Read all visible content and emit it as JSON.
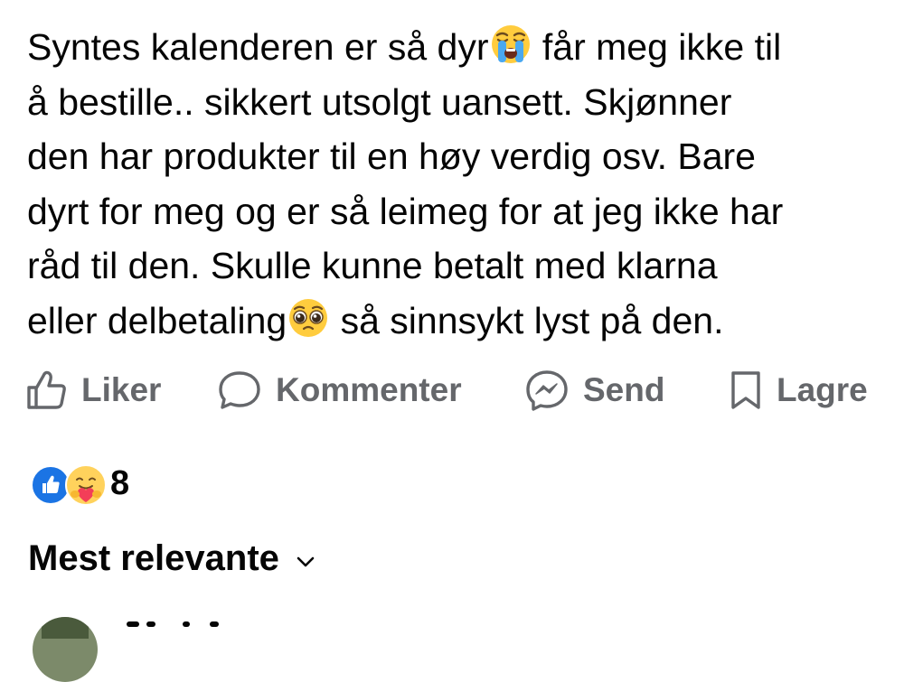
{
  "post": {
    "lines": [
      {
        "before": "Syntes kalenderen er så dyr",
        "emoji": "loudly-crying-face",
        "after": " får meg ikke til"
      },
      {
        "text": "å bestille.. sikkert utsolgt uansett. Skjønner"
      },
      {
        "text": "den har produkter til en høy verdig osv. Bare"
      },
      {
        "text": "dyrt for meg og er så leimeg for at jeg ikke har"
      },
      {
        "text": "råd til den. Skulle kunne betalt med klarna"
      },
      {
        "before": "eller delbetaling",
        "emoji": "pleading-face",
        "after": " så sinnsykt lyst på den."
      }
    ]
  },
  "actions": {
    "like": {
      "label": "Liker",
      "icon": "thumbs-up-outline-icon"
    },
    "comment": {
      "label": "Kommenter",
      "icon": "speech-bubble-icon"
    },
    "send": {
      "label": "Send",
      "icon": "messenger-icon"
    },
    "save": {
      "label": "Lagre",
      "icon": "bookmark-icon"
    }
  },
  "reactions": {
    "count": "8",
    "types": [
      "like",
      "care"
    ],
    "colors": {
      "like": "#1b74e4",
      "care": "#ffd25c",
      "heart": "#f33e58"
    }
  },
  "comments": {
    "sort_label": "Mest relevante",
    "sort_icon": "chevron-down-icon"
  },
  "colors": {
    "text": "#050505",
    "secondary": "#65676b",
    "background": "#ffffff"
  }
}
